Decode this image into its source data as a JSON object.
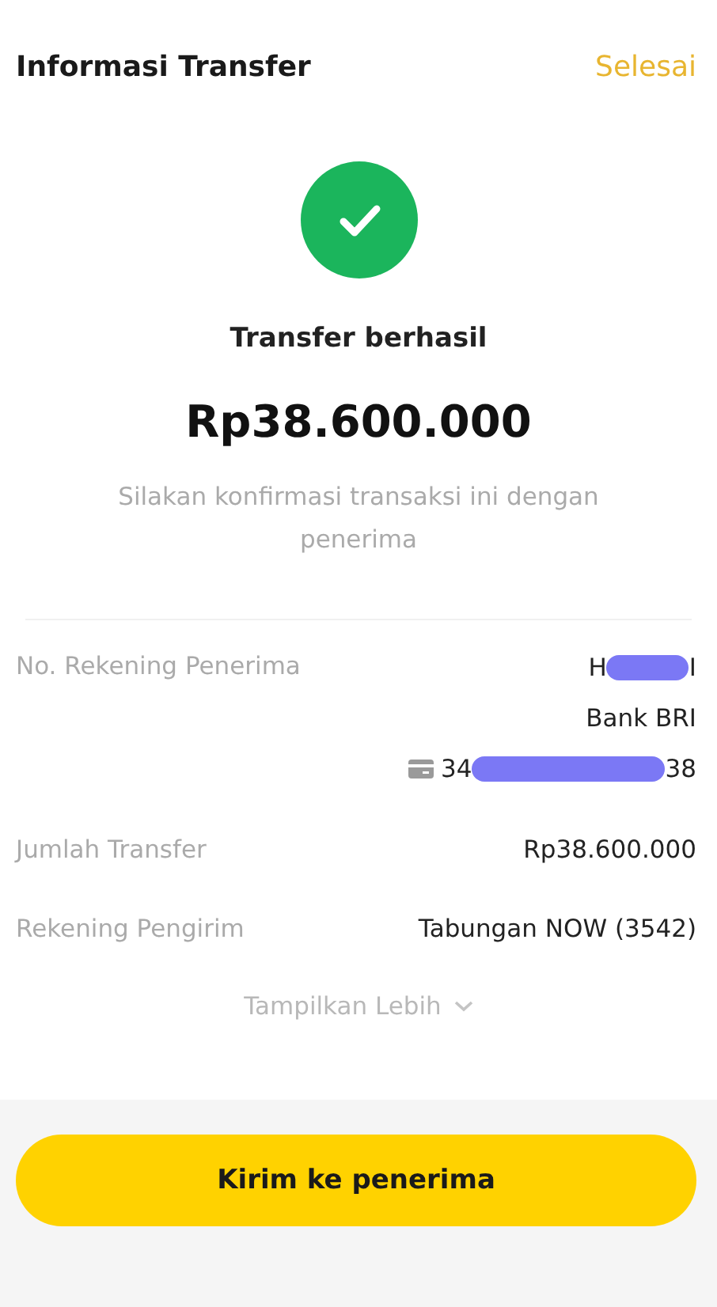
{
  "header": {
    "title": "Informasi Transfer",
    "action": "Selesai"
  },
  "status": {
    "title": "Transfer berhasil",
    "amount": "Rp38.600.000",
    "note": "Silakan konfirmasi transaksi ini dengan penerima"
  },
  "recipient": {
    "label": "No. Rekening Penerima",
    "name_start": "H",
    "name_end": "I",
    "bank": "Bank BRI",
    "account_start": "34",
    "account_end": "38"
  },
  "details": [
    {
      "label": "Jumlah Transfer",
      "value": "Rp38.600.000"
    },
    {
      "label": "Rekening Pengirim",
      "value": "Tabungan NOW (3542)"
    }
  ],
  "more": {
    "label": "Tampilkan Lebih",
    "expanded": false
  },
  "button": "Kirim ke penerima"
}
